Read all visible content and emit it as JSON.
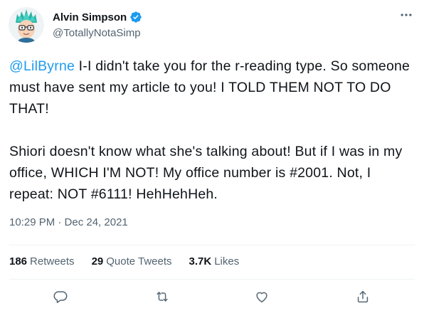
{
  "author": {
    "display_name": "Alvin Simpson",
    "handle": "@TotallyNotaSimp"
  },
  "tweet": {
    "mention": "@LilByrne",
    "paragraph1_rest": " I-I didn't take you for the r-reading type. So someone must have sent my article to you! I TOLD THEM NOT TO DO THAT!",
    "paragraph2": "Shiori doesn't know what she's talking about! But if I was in my office, WHICH I'M NOT! My office number is #2001. Not, I repeat: NOT #6111! HehHehHeh.",
    "timestamp": "10:29 PM · Dec 24, 2021"
  },
  "stats": {
    "retweets_count": "186",
    "retweets_label": "Retweets",
    "quotes_count": "29",
    "quotes_label": "Quote Tweets",
    "likes_count": "3.7K",
    "likes_label": "Likes"
  },
  "icons": {
    "verified": "verified-badge-icon",
    "more": "more-options-icon",
    "reply": "reply-icon",
    "retweet": "retweet-icon",
    "like": "like-icon",
    "share": "share-icon"
  },
  "colors": {
    "accent": "#1d9bf0",
    "text_primary": "#0f1419",
    "text_secondary": "#536471",
    "divider": "#eff3f4"
  }
}
